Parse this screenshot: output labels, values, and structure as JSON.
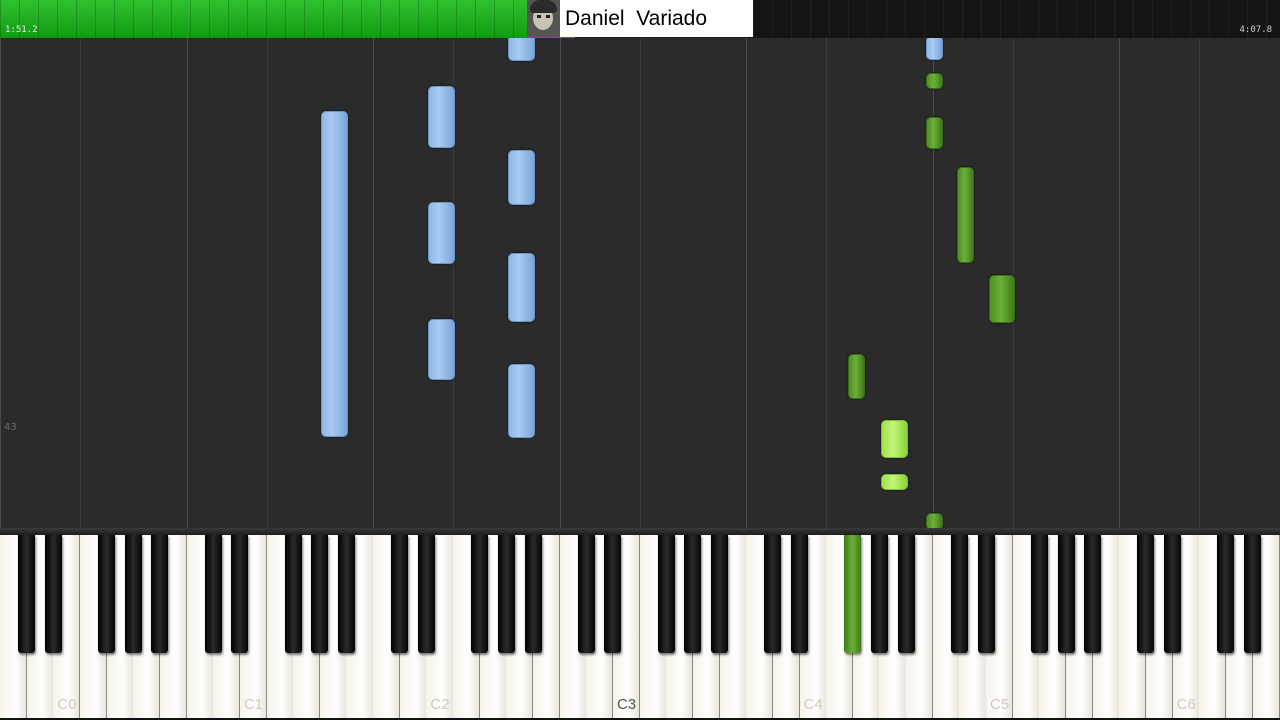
{
  "header": {
    "time_elapsed": "1:51.2",
    "time_total": "4:07.8",
    "channel_name": "Daniel  Variado",
    "playback_fraction": 0.449,
    "progress_color": "#1fb21f"
  },
  "roll": {
    "row_marker": "43"
  },
  "notes": [
    {
      "track": "blue"
    },
    {
      "track": "blue"
    },
    {
      "track": "blue"
    },
    {
      "track": "blue"
    },
    {
      "track": "blue"
    },
    {
      "track": "blue"
    },
    {
      "track": "blue"
    },
    {
      "track": "blue"
    },
    {
      "track": "blue"
    },
    {
      "track": "green"
    },
    {
      "track": "green"
    },
    {
      "track": "green"
    },
    {
      "track": "green"
    },
    {
      "track": "green"
    },
    {
      "track": "green"
    },
    {
      "track": "lime"
    },
    {
      "track": "lime"
    },
    {
      "track": "lime"
    }
  ],
  "track_colors": {
    "blue": "#9cc0ee",
    "green": "#5c9e2c",
    "lime": "#b4ee5f"
  },
  "keyboard": {
    "octave_labels": [
      "C0",
      "C1",
      "C2",
      "C3",
      "C4",
      "C5",
      "C6"
    ],
    "current_octave": "C3",
    "pressed_key": "F#4"
  }
}
